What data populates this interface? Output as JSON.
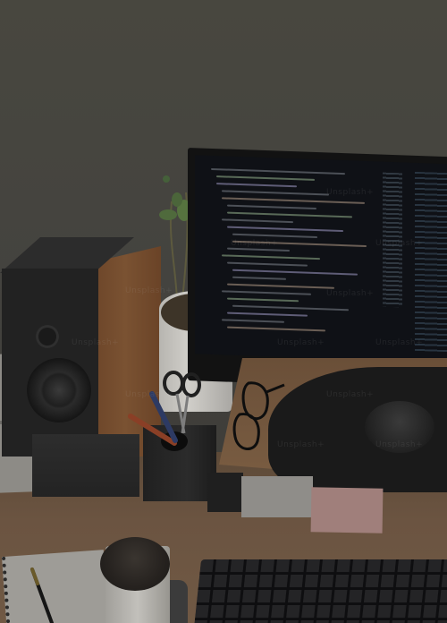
{
  "image": {
    "subject": "Desk setup with monitor, speaker, plant, pen holder, glasses, coffee cup, notebook and keyboard",
    "watermark_text": "Unsplash+"
  },
  "colors": {
    "wall": "#45443f",
    "desk_wood": "#6e5640",
    "monitor_frame": "#151515",
    "screen_bg": "#111318",
    "speaker_body": "#262626",
    "speaker_wood": "#7a4f2e",
    "plant_pot": "#c9c7c2",
    "keyboard": "#1c1c1e",
    "sticky_note": "#b08080"
  }
}
